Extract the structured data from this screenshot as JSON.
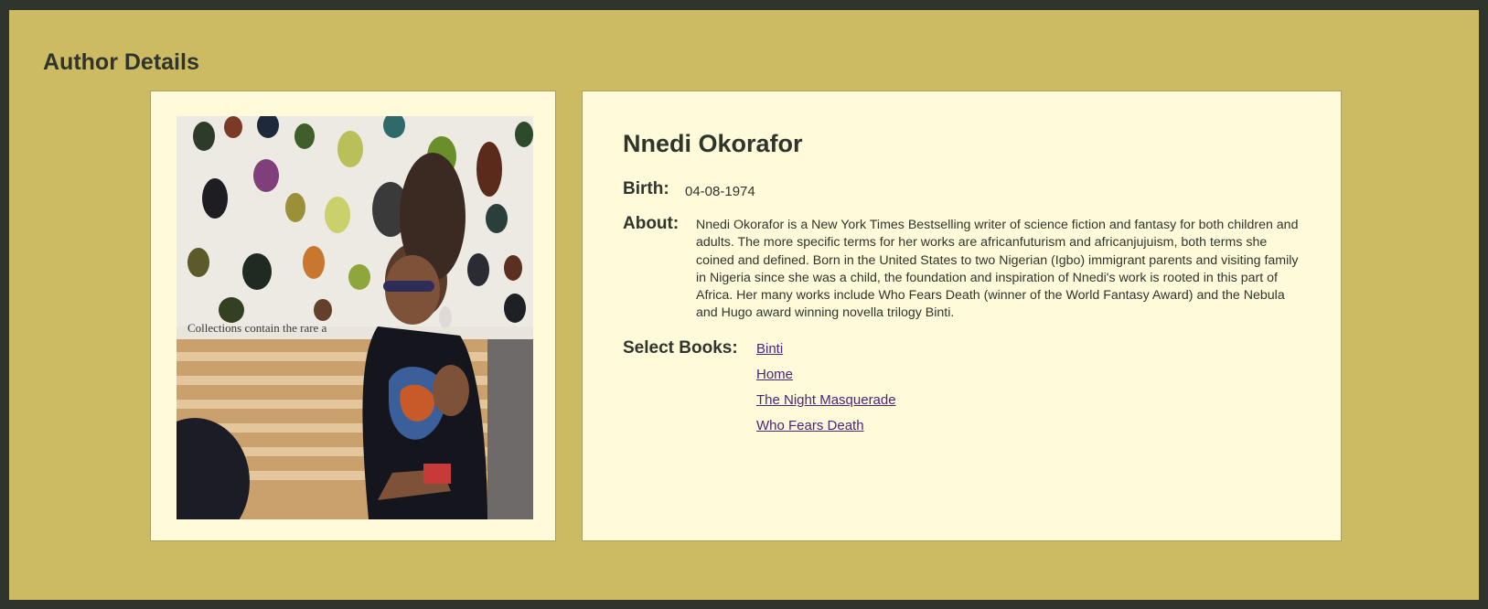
{
  "page": {
    "title": "Author Details"
  },
  "author": {
    "photo_alt": "Collections contain the rare a",
    "name": "Nnedi Okorafor",
    "birth_label": "Birth:",
    "birth": "04-08-1974",
    "about_label": "About:",
    "about": "Nnedi Okorafor is a New York Times Bestselling writer of science fiction and fantasy for both children and adults. The more specific terms for her works are africanfuturism and africanjujuism, both terms she coined and defined. Born in the United States to two Nigerian (Igbo) immigrant parents and visiting family in Nigeria since she was a child, the foundation and inspiration of Nnedi's work is rooted in this part of Africa. Her many works include Who Fears Death (winner of the World Fantasy Award) and the Nebula and Hugo award winning novella trilogy Binti.",
    "books_label": "Select Books:",
    "books": [
      "Binti",
      "Home",
      "The Night Masquerade",
      "Who Fears Death"
    ]
  },
  "colors": {
    "outer_border": "#2f352d",
    "background": "#cdbb63",
    "card": "#fffbda",
    "text": "#2f352d",
    "link": "#4b2576"
  }
}
